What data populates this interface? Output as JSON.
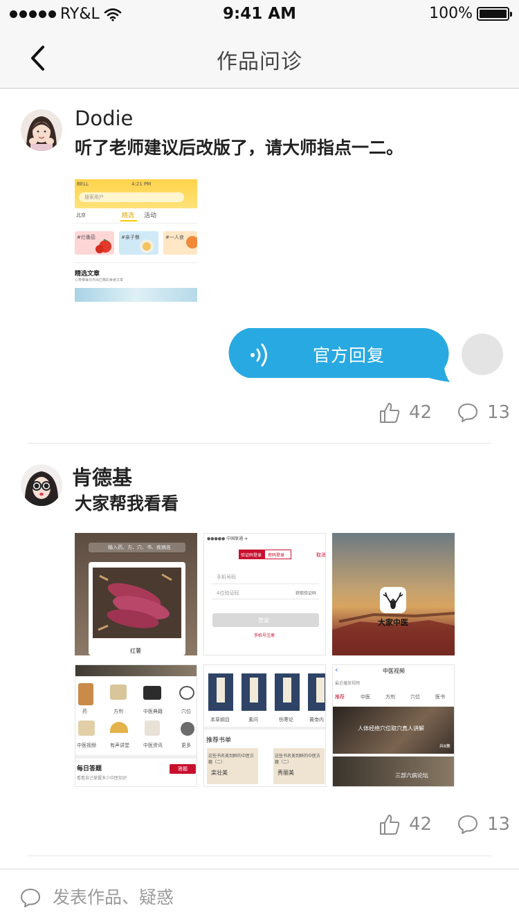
{
  "status_bar": {
    "carrier": "RY&L",
    "time": "9:41 AM",
    "battery": "100%"
  },
  "nav": {
    "title": "作品问诊"
  },
  "posts": [
    {
      "username": "Dodie",
      "text": "听了老师建议后改版了，请大师指点一二。",
      "likes": "42",
      "comments": "13",
      "images": [
        {
          "time": "4:21 PM",
          "carrier": "BELL",
          "search_placeholder": "搜索用户",
          "city": "北京",
          "tab_selected": "精选",
          "tab_other": "活动",
          "tag1": "#烂番茄",
          "tag2": "#亲子餐",
          "tag3": "#一人食",
          "section_title": "精选文章",
          "section_sub": "心寿推每日杰出烂精彩美食文章"
        }
      ]
    },
    {
      "username": "肯德基",
      "text": "大家帮我看看",
      "likes": "42",
      "comments": "13",
      "images": [
        {
          "search": "输入药、方、穴、书、疾病名",
          "caption": "红薯"
        },
        {
          "tab1": "验证码登录",
          "tab2": "密码登录",
          "cancel": "取消",
          "phone": "手机号码",
          "code": "4位验证码",
          "get_code": "获取验证码",
          "login": "登录",
          "register": "手机号注册"
        },
        {
          "app_name": "大家中医"
        },
        {
          "items": [
            "药",
            "方剂",
            "中医典籍",
            "穴位",
            "中医视频",
            "有声讲堂",
            "中医资讯",
            "更多"
          ],
          "daily": "每日答题",
          "daily_sub": "看看自己掌握多少中医知识",
          "answer_btn": "答题"
        },
        {
          "books": [
            "本草纲目",
            "素问",
            "伤寒论",
            "黄帝内"
          ],
          "rec": "推荐书单",
          "card1_title": "这些书名美到醉的中医古籍（二）",
          "card1_name": "栾壮美",
          "card2_title": "这些书名美到醉的中医古籍（二）",
          "card2_name": "秀丽美"
        },
        {
          "header": "中医视频",
          "sub": "最近播放视频",
          "tabs": [
            "推荐",
            "中医",
            "方剂",
            "穴位",
            "医书"
          ],
          "video1": "人体经络穴位取穴真人讲解",
          "video1_count": "共8集",
          "video2": "三部六病论坛"
        }
      ]
    }
  ],
  "reply": {
    "label": "官方回复"
  },
  "composer": {
    "placeholder": "发表作品、疑惑"
  },
  "colors": {
    "accent_blue": "#29a9e1",
    "brand_yellow": "#ffd84d",
    "red": "#c8102e"
  }
}
